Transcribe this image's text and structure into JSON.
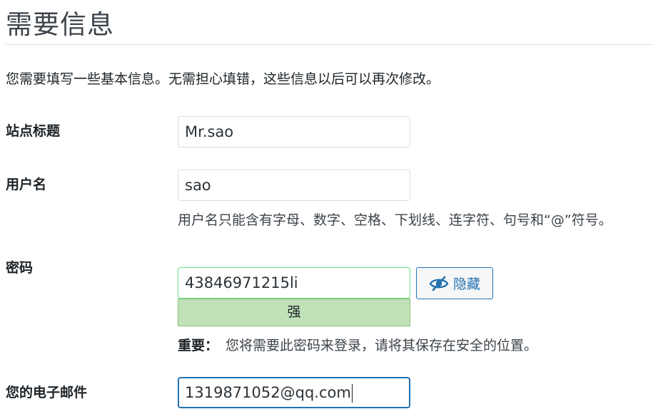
{
  "page": {
    "title": "需要信息",
    "intro": "您需要填写一些基本信息。无需担心填错，这些信息以后可以再次修改。"
  },
  "form": {
    "site_title": {
      "label": "站点标题",
      "value": "Mr.sao"
    },
    "username": {
      "label": "用户名",
      "value": "sao",
      "hint": "用户名只能含有字母、数字、空格、下划线、连字符、句号和“@”符号。"
    },
    "password": {
      "label": "密码",
      "value": "43846971215li",
      "toggle_label": "隐藏",
      "toggle_icon": "eye-slash-icon",
      "strength": "强",
      "note_strong": "重要：",
      "note": "您将需要此密码来登录，请将其保存在安全的位置。"
    },
    "email": {
      "label": "您的电子邮件",
      "value": "1319871052@qq.com"
    }
  },
  "colors": {
    "accent": "#2271b1",
    "strength_bg": "#c1e1b9",
    "strength_border": "#83c373"
  }
}
